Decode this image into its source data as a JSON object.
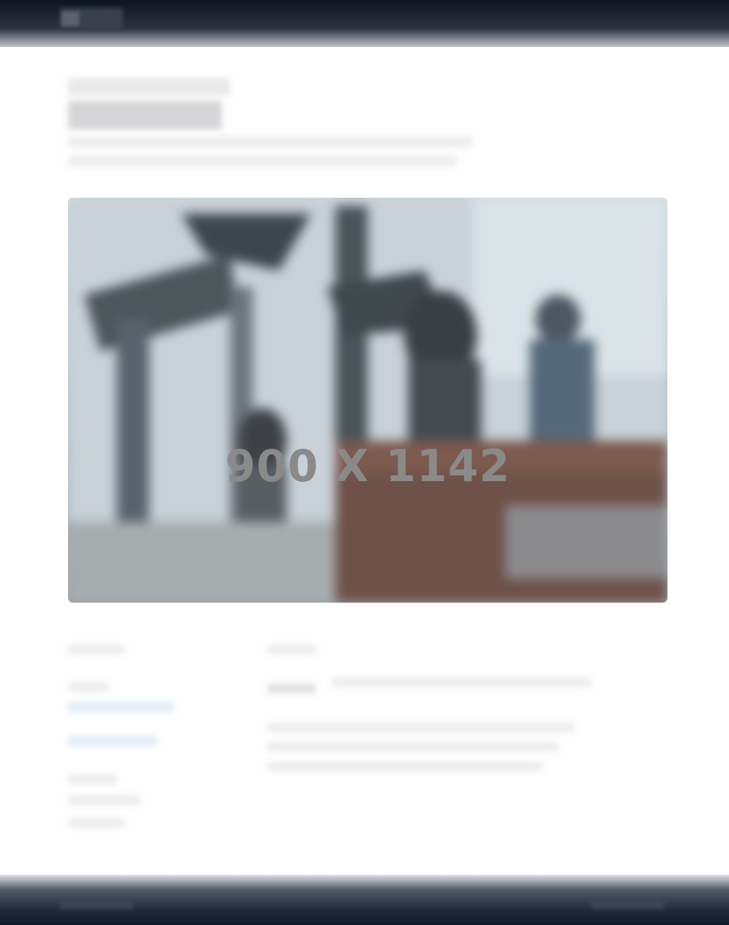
{
  "hero": {
    "placeholder_label": "900 X 1142"
  },
  "colors": {
    "header_bg": "#0f1424",
    "footer_bg": "#121827",
    "page_bg": "#ffffff",
    "placeholder_text": "#8a8a8a"
  }
}
